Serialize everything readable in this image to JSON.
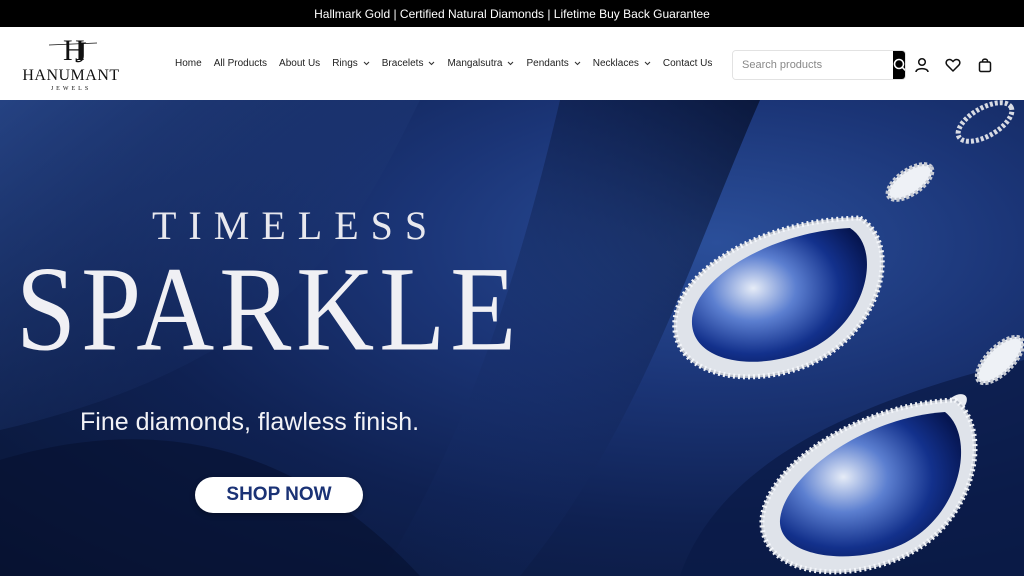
{
  "announcement": "Hallmark Gold | Certified Natural Diamonds | Lifetime Buy Back Guarantee",
  "brand": {
    "name": "HANUMANT",
    "sub": "JEWELS",
    "monogram": "HJ"
  },
  "nav": {
    "items": [
      {
        "label": "Home",
        "dropdown": false
      },
      {
        "label": "All Products",
        "dropdown": false
      },
      {
        "label": "About Us",
        "dropdown": false
      },
      {
        "label": "Rings",
        "dropdown": true
      },
      {
        "label": "Bracelets",
        "dropdown": true
      },
      {
        "label": "Mangalsutra",
        "dropdown": true
      },
      {
        "label": "Pendants",
        "dropdown": true
      },
      {
        "label": "Necklaces",
        "dropdown": true
      },
      {
        "label": "Contact Us",
        "dropdown": false
      }
    ]
  },
  "search": {
    "placeholder": "Search products",
    "icon": "search-icon"
  },
  "header_icons": [
    "user-icon",
    "heart-icon",
    "bag-icon"
  ],
  "hero": {
    "title_line1": "TIMELESS",
    "title_line2": "SPARKLE",
    "subtitle": "Fine diamonds, flawless finish.",
    "cta": "SHOP NOW"
  },
  "colors": {
    "announce_bg": "#000000",
    "hero_blue": "#1b3577",
    "cta_text": "#1a3275"
  }
}
